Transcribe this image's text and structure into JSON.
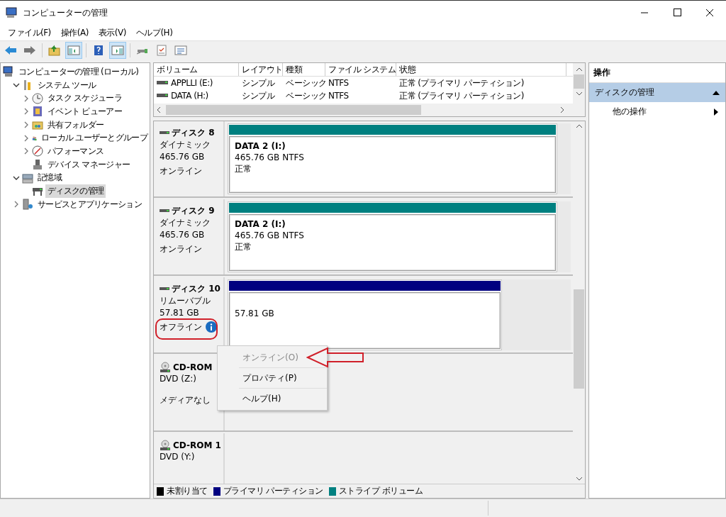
{
  "window": {
    "title": "コンピューターの管理"
  },
  "menu": [
    "ファイル(F)",
    "操作(A)",
    "表示(V)",
    "ヘルプ(H)"
  ],
  "toolbar": [
    {
      "pressed": false
    },
    {
      "pressed": false
    },
    {
      "pressed": false
    },
    {
      "pressed": true
    },
    {
      "pressed": false
    },
    {
      "pressed": true
    },
    {
      "pressed": false
    },
    {
      "pressed": false
    },
    {
      "pressed": false
    }
  ],
  "tree": [
    {
      "label": "コンピューターの管理 (ローカル)",
      "selected": false,
      "children": [
        {
          "label": "システム ツール",
          "expanded": true,
          "selected": false,
          "children": [
            {
              "label": "タスク スケジューラ",
              "expanded": false,
              "selected": false
            },
            {
              "label": "イベント ビューアー",
              "expanded": false,
              "selected": false
            },
            {
              "label": "共有フォルダー",
              "expanded": false,
              "selected": false
            },
            {
              "label": "ローカル ユーザーとグループ",
              "expanded": false,
              "selected": false
            },
            {
              "label": "パフォーマンス",
              "expanded": false,
              "selected": false
            },
            {
              "label": "デバイス マネージャー",
              "selected": false
            }
          ]
        },
        {
          "label": "記憶域",
          "expanded": true,
          "selected": false,
          "children": [
            {
              "label": "ディスクの管理",
              "selected": true
            }
          ]
        },
        {
          "label": "サービスとアプリケーション",
          "expanded": false,
          "selected": false
        }
      ]
    }
  ],
  "volume_list": {
    "columns": [
      "ボリューム",
      "レイアウト",
      "種類",
      "ファイル システム",
      "状態"
    ],
    "rows": [
      [
        "APPLLI (E:)",
        "シンプル",
        "ベーシック",
        "NTFS",
        "正常 (プライマリ パーティション)"
      ],
      [
        "DATA (H:)",
        "シンプル",
        "ベーシック",
        "NTFS",
        "正常 (プライマリ パーティション)"
      ]
    ]
  },
  "disks": [
    {
      "kind": "disk",
      "name": "ディスク 8",
      "type": "ダイナミック",
      "size": "465.76 GB",
      "status": "オンライン",
      "info": false,
      "partition": {
        "color": "#008080",
        "level": 0.96,
        "label": "DATA 2  (I:)",
        "detail": "465.76 GB NTFS",
        "state": "正常"
      }
    },
    {
      "kind": "disk",
      "name": "ディスク 9",
      "type": "ダイナミック",
      "size": "465.76 GB",
      "status": "オンライン",
      "info": false,
      "partition": {
        "color": "#008080",
        "level": 0.96,
        "label": "DATA 2  (I:)",
        "detail": "465.76 GB NTFS",
        "state": "正常"
      }
    },
    {
      "kind": "disk",
      "name": "ディスク 10",
      "type": "リムーバブル",
      "size": "57.81 GB",
      "status": "オフライン",
      "info": true,
      "partition": {
        "color": "#000080",
        "level": 0.8,
        "detail": "57.81 GB"
      }
    },
    {
      "kind": "cdrom",
      "name": "CD-ROM",
      "type": "DVD (Z:)",
      "status": "メディアなし"
    },
    {
      "kind": "cdrom",
      "name": "CD-ROM 1",
      "type": "DVD (Y:)"
    }
  ],
  "legend": [
    {
      "label": "未割り当て",
      "color": "#000000"
    },
    {
      "label": "プライマリ パーティション",
      "color": "#000080"
    },
    {
      "label": "ストライプ ボリューム",
      "color": "#008080"
    }
  ],
  "context_menu": [
    {
      "label": "オンライン(O)",
      "disabled": true
    },
    {
      "label": "プロパティ(P)",
      "disabled": false
    },
    {
      "label": "ヘルプ(H)",
      "disabled": false
    }
  ],
  "actions": {
    "title": "操作",
    "section": "ディスクの管理",
    "items": [
      "他の操作"
    ]
  }
}
